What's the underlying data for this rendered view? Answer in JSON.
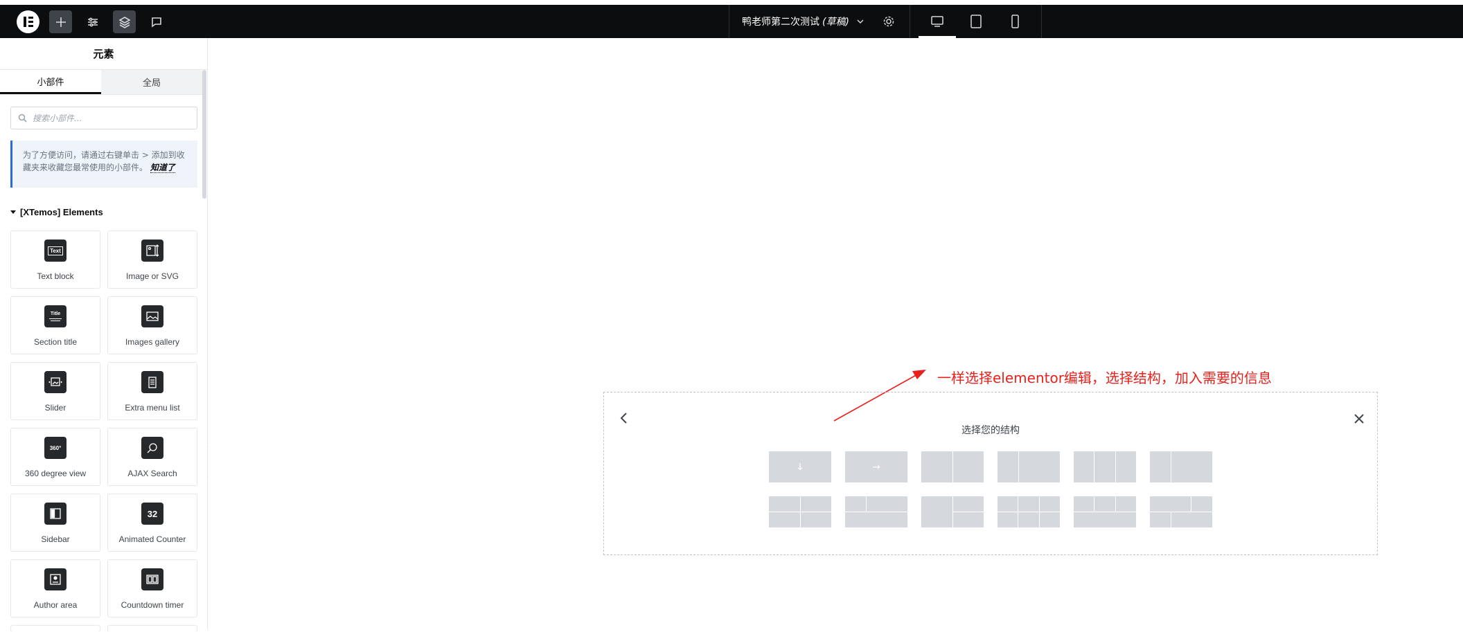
{
  "topbar": {
    "document_title": "鸭老师第二次测试",
    "document_state": "(草稿)",
    "tools": [
      "add-element",
      "site-settings",
      "structure",
      "comments"
    ]
  },
  "panel": {
    "title": "元素",
    "tabs": [
      {
        "label": "小部件",
        "active": true
      },
      {
        "label": "全局",
        "active": false
      }
    ],
    "search_placeholder": "搜索小部件...",
    "notice_text": "为了方便访问，请通过右键单击 > 添加到收藏夹来收藏您最常使用的小部件。",
    "notice_link": "知道了",
    "category": "[XTemos] Elements",
    "widgets": [
      {
        "label": "Text block",
        "icon": "text-block-icon"
      },
      {
        "label": "Image or SVG",
        "icon": "image-svg-icon"
      },
      {
        "label": "Section title",
        "icon": "section-title-icon"
      },
      {
        "label": "Images gallery",
        "icon": "images-gallery-icon"
      },
      {
        "label": "Slider",
        "icon": "slider-icon"
      },
      {
        "label": "Extra menu list",
        "icon": "extra-menu-list-icon"
      },
      {
        "label": "360 degree view",
        "icon": "360-view-icon"
      },
      {
        "label": "AJAX Search",
        "icon": "ajax-search-icon"
      },
      {
        "label": "Sidebar",
        "icon": "sidebar-icon"
      },
      {
        "label": "Animated Counter",
        "icon": "animated-counter-icon"
      },
      {
        "label": "Author area",
        "icon": "author-area-icon"
      },
      {
        "label": "Countdown timer",
        "icon": "countdown-timer-icon"
      }
    ],
    "icon_text": {
      "text": "Text",
      "title": "Title",
      "360": "360°",
      "counter": "32"
    }
  },
  "canvas": {
    "annotation": "一样选择elementor编辑，选择结构，加入需要的信息",
    "annotation_color": "#e8211c",
    "structure_title": "选择您的结构",
    "arrow_down": "↓",
    "arrow_right": "→"
  },
  "colors": {
    "topbar": "#0c0d0e",
    "preset": "#d5d8dc",
    "notice_border": "#2d6bd8"
  }
}
